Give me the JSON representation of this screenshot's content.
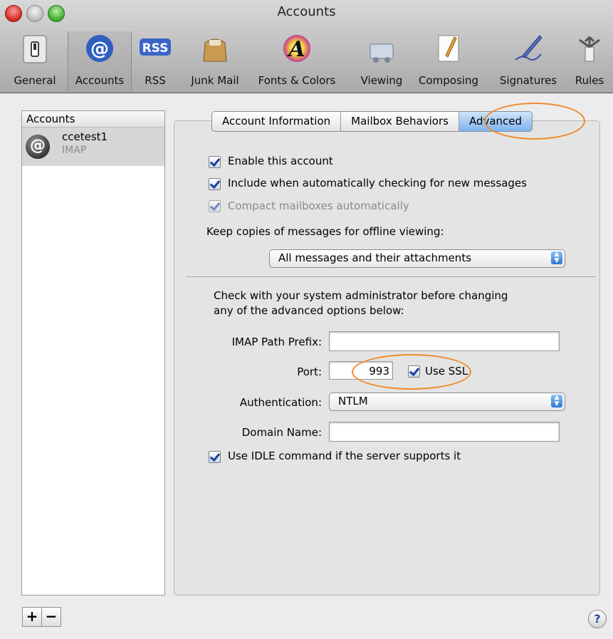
{
  "window": {
    "title": "Accounts"
  },
  "toolbar": [
    {
      "label": "General",
      "icon": "switch-icon"
    },
    {
      "label": "Accounts",
      "icon": "at-sign-icon"
    },
    {
      "label": "RSS",
      "icon": "rss-icon"
    },
    {
      "label": "Junk Mail",
      "icon": "junk-bag-icon"
    },
    {
      "label": "Fonts & Colors",
      "icon": "font-color-icon"
    },
    {
      "label": "Viewing",
      "icon": "viewing-icon"
    },
    {
      "label": "Composing",
      "icon": "pencil-paper-icon"
    },
    {
      "label": "Signatures",
      "icon": "pen-signature-icon"
    },
    {
      "label": "Rules",
      "icon": "rules-arrows-icon"
    }
  ],
  "toolbar_selected": "Accounts",
  "sidebar": {
    "header": "Accounts",
    "accounts": [
      {
        "name": "ccetest1",
        "type": "IMAP",
        "icon_glyph": "@"
      }
    ],
    "add_label": "+",
    "remove_label": "−"
  },
  "tabs": [
    {
      "label": "Account Information",
      "active": false
    },
    {
      "label": "Mailbox Behaviors",
      "active": false
    },
    {
      "label": "Advanced",
      "active": true
    }
  ],
  "advanced": {
    "enable_account": {
      "label": "Enable this account",
      "checked": true
    },
    "include_checking": {
      "label": "Include when automatically checking for new messages",
      "checked": true
    },
    "compact_mailboxes": {
      "label": "Compact mailboxes automatically",
      "checked": true,
      "disabled": true
    },
    "keep_copies_label": "Keep copies of messages for offline viewing:",
    "keep_copies_value": "All messages and their attachments",
    "admin_note_line1": "Check with your system administrator before changing",
    "admin_note_line2": "any of the advanced options below:",
    "imap_prefix_label": "IMAP Path Prefix:",
    "imap_prefix_value": "",
    "port_label": "Port:",
    "port_value": "993",
    "use_ssl": {
      "label": "Use SSL",
      "checked": true
    },
    "auth_label": "Authentication:",
    "auth_value": "NTLM",
    "domain_label": "Domain Name:",
    "domain_value": "",
    "idle": {
      "label": "Use IDLE command if the server supports it",
      "checked": true
    }
  },
  "help_label": "?",
  "colors": {
    "annotation_oval": "#f08a2c",
    "selected_tab": "#7eb3ee",
    "check_mark": "#1c3f9c"
  }
}
